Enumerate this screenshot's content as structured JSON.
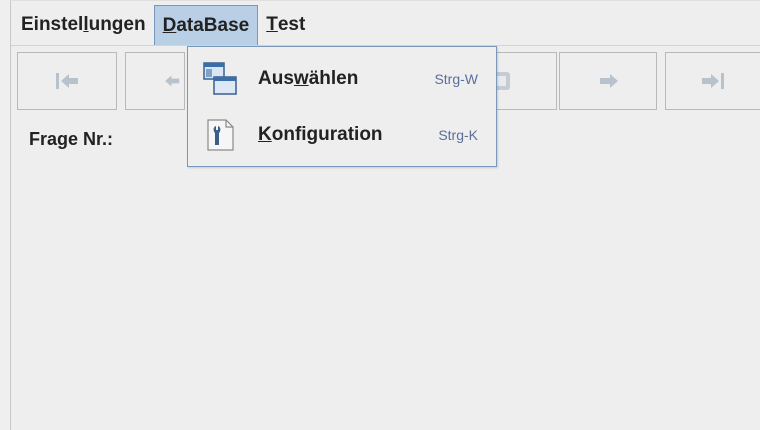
{
  "menubar": {
    "items": [
      {
        "label_pre": "Einstel",
        "label_ul": "l",
        "label_post": "ungen"
      },
      {
        "label_pre": "",
        "label_ul": "D",
        "label_post": "ataBase"
      },
      {
        "label_pre": "",
        "label_ul": "T",
        "label_post": "est"
      }
    ]
  },
  "toolbar": {
    "buttons": [
      {
        "icon": "first-record-icon"
      },
      {
        "icon": "previous-record-icon"
      },
      {
        "icon": "record-icon"
      },
      {
        "icon": "next-record-icon"
      },
      {
        "icon": "last-record-icon"
      }
    ]
  },
  "main": {
    "frage_label": "Frage Nr.:"
  },
  "dropdown": {
    "items": [
      {
        "label_pre": "Aus",
        "label_ul": "w",
        "label_post": "ählen",
        "accelerator": "Strg-W",
        "icon": "database-windows-icon"
      },
      {
        "label_pre": "",
        "label_ul": "K",
        "label_post": "onfiguration",
        "accelerator": "Strg-K",
        "icon": "wrench-document-icon"
      }
    ]
  },
  "colors": {
    "menu_highlight": "#b8cfe5",
    "accelerator": "#5a6f9a",
    "disabled_icon": "#b8c2cc"
  }
}
